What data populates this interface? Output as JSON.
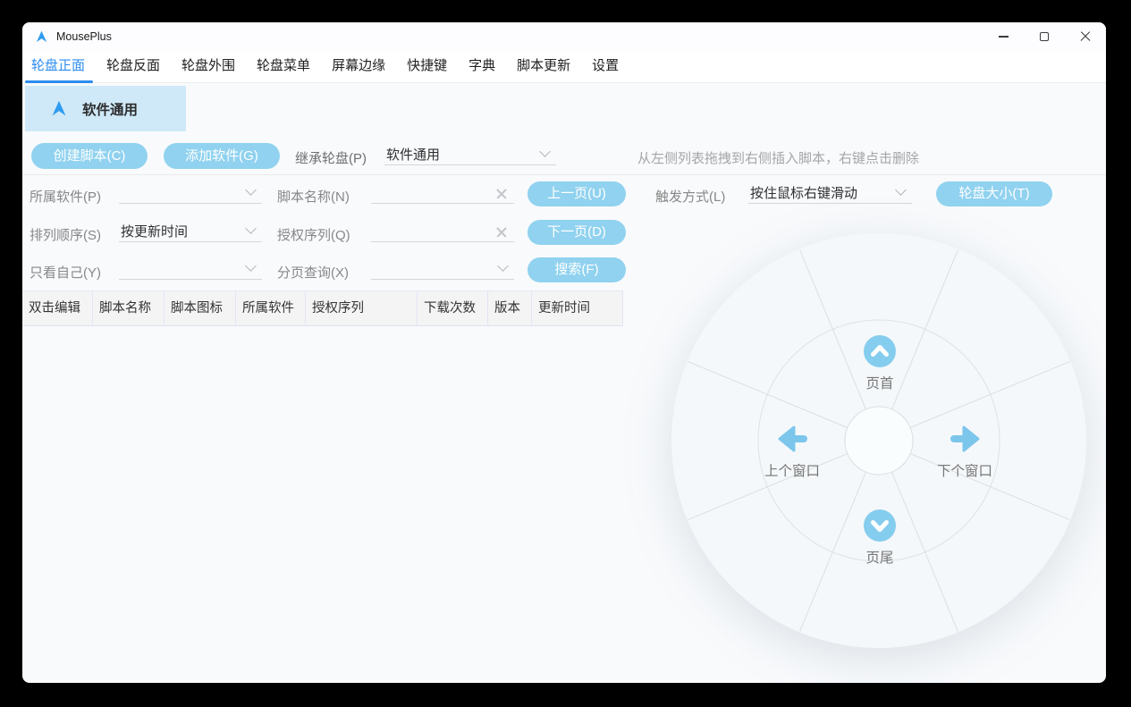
{
  "titlebar": {
    "title": "MousePlus"
  },
  "tabs": [
    {
      "label": "轮盘正面",
      "active": true
    },
    {
      "label": "轮盘反面",
      "active": false
    },
    {
      "label": "轮盘外围",
      "active": false
    },
    {
      "label": "轮盘菜单",
      "active": false
    },
    {
      "label": "屏幕边缘",
      "active": false
    },
    {
      "label": "快捷键",
      "active": false
    },
    {
      "label": "字典",
      "active": false
    },
    {
      "label": "脚本更新",
      "active": false
    },
    {
      "label": "设置",
      "active": false
    }
  ],
  "selected_wheel": {
    "label": "软件通用"
  },
  "toolbar": {
    "create_script": "创建脚本(C)",
    "add_software": "添加软件(G)",
    "inherit_label": "继承轮盘(P)",
    "inherit_value": "软件通用",
    "hint": "从左侧列表拖拽到右侧插入脚本，右键点击删除"
  },
  "filters": {
    "row1": {
      "left_label": "所属软件(P)",
      "left_value": "",
      "mid_label": "脚本名称(N)",
      "mid_value": "",
      "button": "上一页(U)"
    },
    "row2": {
      "left_label": "排列顺序(S)",
      "left_value": "按更新时间",
      "mid_label": "授权序列(Q)",
      "mid_value": "",
      "button": "下一页(D)"
    },
    "row3": {
      "left_label": "只看自己(Y)",
      "left_value": "",
      "mid_label": "分页查询(X)",
      "mid_value": "",
      "button": "搜索(F)"
    }
  },
  "trigger": {
    "label": "触发方式(L)",
    "value": "按住鼠标右键滑动",
    "wheel_size_button": "轮盘大小(T)"
  },
  "table": {
    "columns": [
      "双击编辑",
      "脚本名称",
      "脚本图标",
      "所属软件",
      "授权序列",
      "下载次数",
      "版本",
      "更新时间"
    ]
  },
  "wheel": {
    "top": {
      "label": "页首",
      "icon": "chevron-up-circle-icon"
    },
    "left": {
      "label": "上个窗口",
      "icon": "arrow-left-icon"
    },
    "right": {
      "label": "下个窗口",
      "icon": "arrow-right-icon"
    },
    "bottom": {
      "label": "页尾",
      "icon": "chevron-down-circle-icon"
    }
  },
  "colors": {
    "accent": "#2d8cf0",
    "button_blue": "#90d2ef",
    "selected_bg": "#cfe9f8",
    "wheel_icon_blue": "#82cbed",
    "content_bg": "#f8fafc"
  }
}
